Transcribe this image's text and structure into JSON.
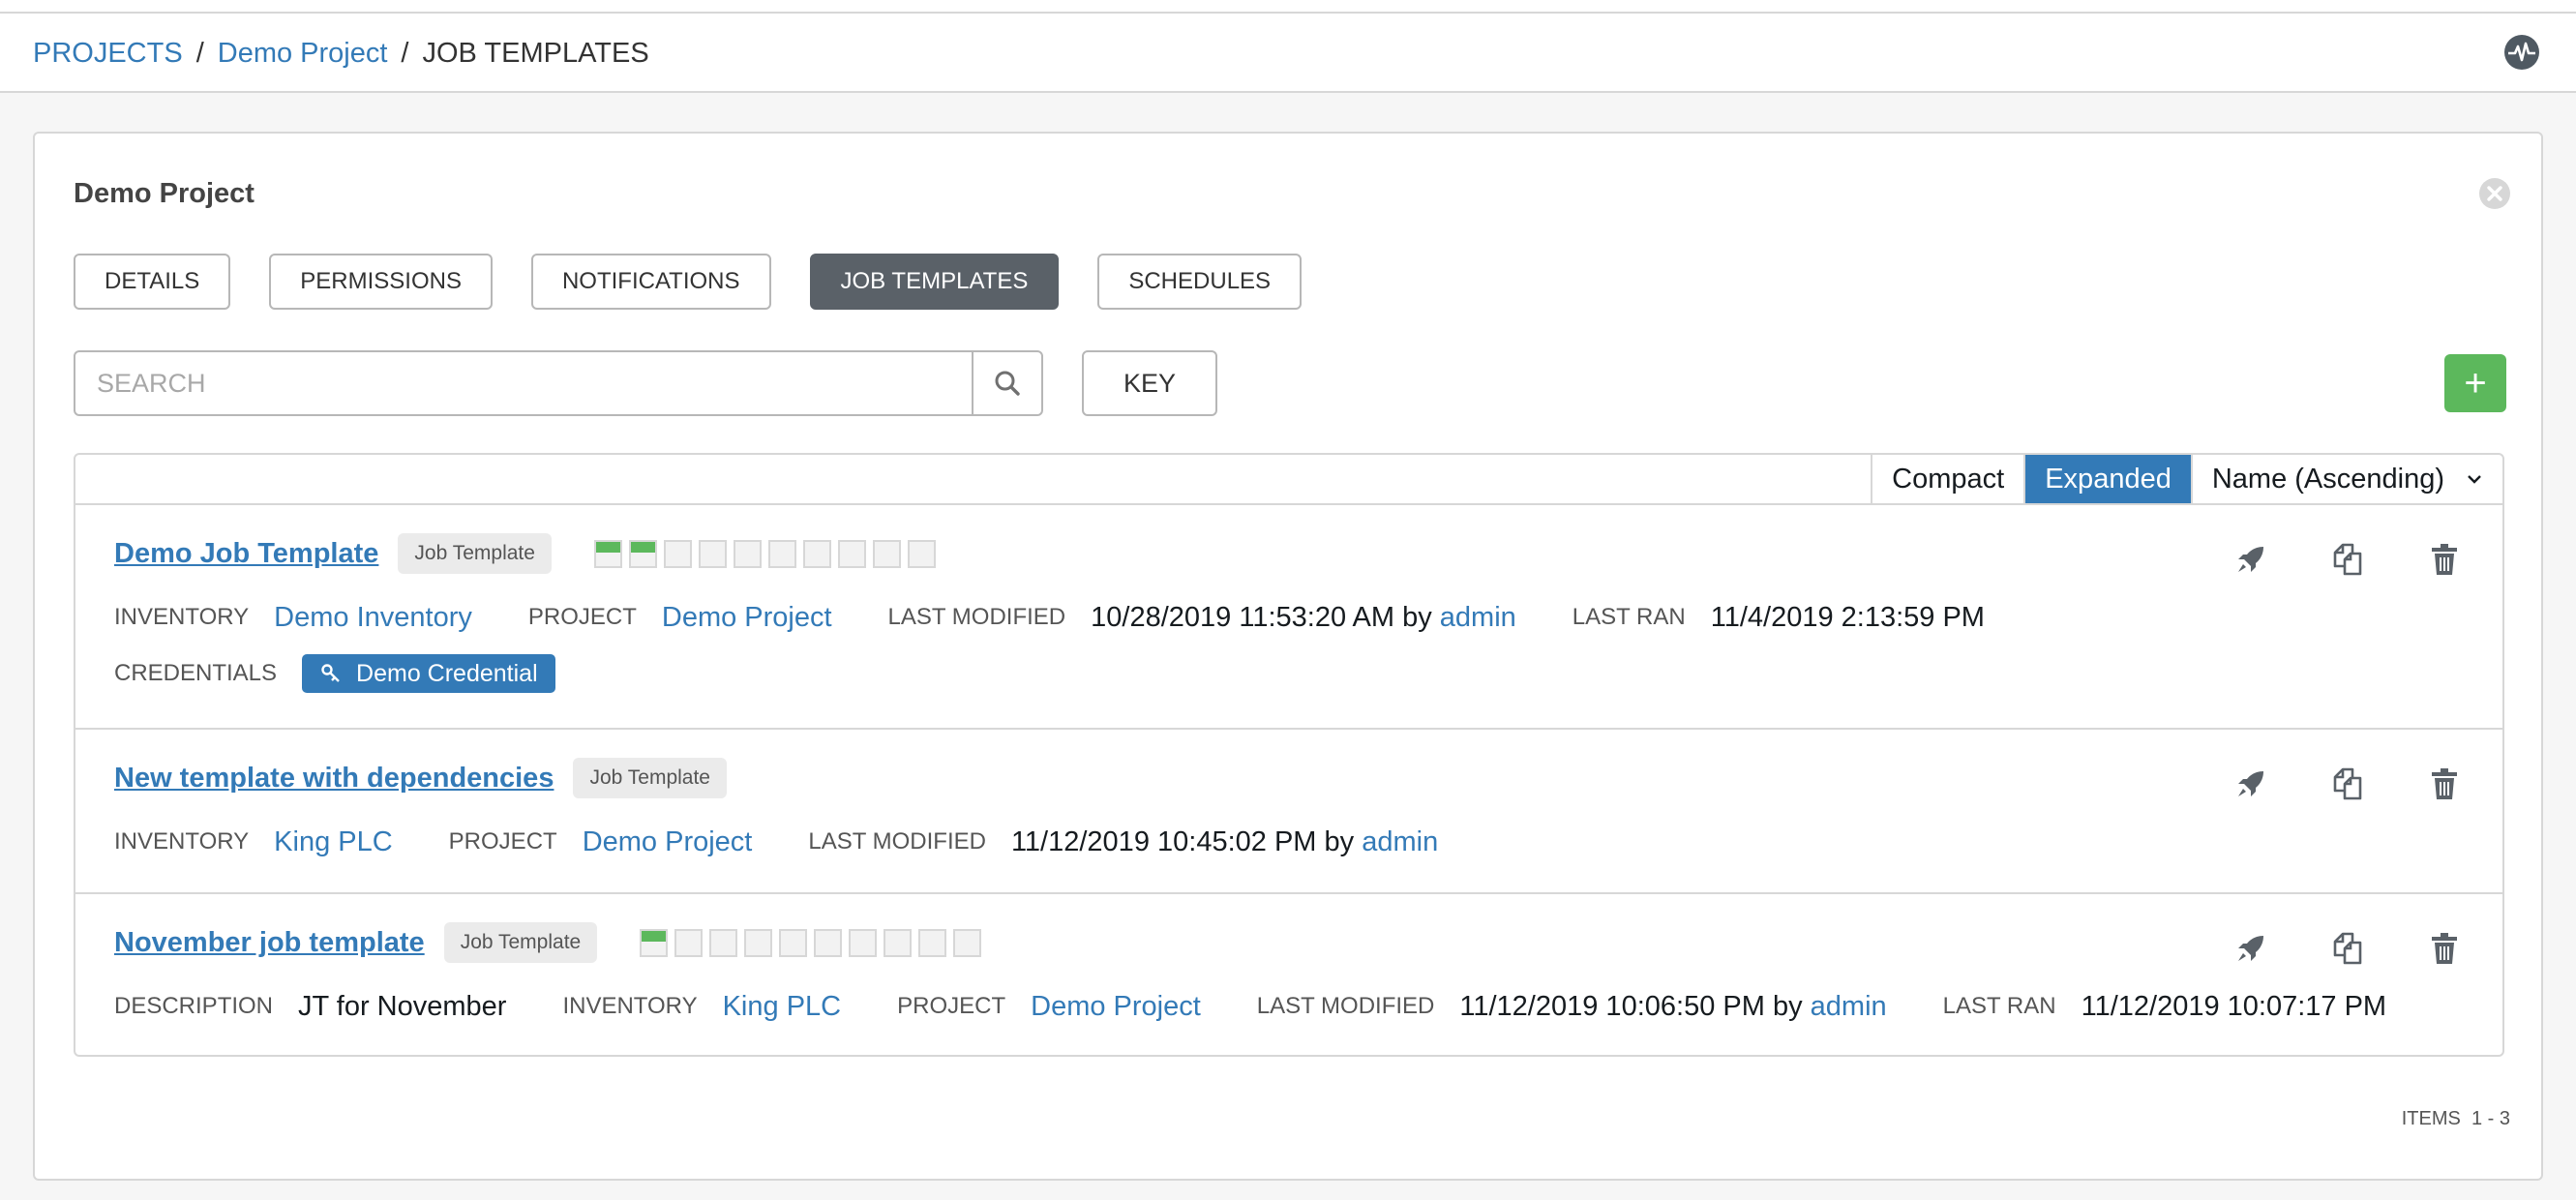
{
  "breadcrumb": {
    "items": [
      "PROJECTS",
      "Demo Project"
    ],
    "current": "JOB TEMPLATES"
  },
  "panel": {
    "title": "Demo Project",
    "tabs": [
      {
        "label": "DETAILS",
        "active": false
      },
      {
        "label": "PERMISSIONS",
        "active": false
      },
      {
        "label": "NOTIFICATIONS",
        "active": false
      },
      {
        "label": "JOB TEMPLATES",
        "active": true
      },
      {
        "label": "SCHEDULES",
        "active": false
      }
    ],
    "search": {
      "placeholder": "SEARCH",
      "value": ""
    },
    "key_label": "KEY",
    "add_label": "+"
  },
  "list_header": {
    "compact_label": "Compact",
    "expanded_label": "Expanded",
    "sort_value": "Name (Ascending)"
  },
  "templates": [
    {
      "name": "Demo Job Template",
      "badge": "Job Template",
      "recent_jobs": [
        "successful",
        "successful",
        "none",
        "none",
        "none",
        "none",
        "none",
        "none",
        "none",
        "none"
      ],
      "inventory_label": "INVENTORY",
      "inventory": "Demo Inventory",
      "project_label": "PROJECT",
      "project": "Demo Project",
      "last_modified_label": "LAST MODIFIED",
      "last_modified": "10/28/2019 11:53:20 AM",
      "by_text": "by",
      "modified_by": "admin",
      "last_ran_label": "LAST RAN",
      "last_ran": "11/4/2019 2:13:59 PM",
      "credentials_label": "CREDENTIALS",
      "credential": "Demo Credential"
    },
    {
      "name": "New template with dependencies",
      "badge": "Job Template",
      "inventory_label": "INVENTORY",
      "inventory": "King PLC",
      "project_label": "PROJECT",
      "project": "Demo Project",
      "last_modified_label": "LAST MODIFIED",
      "last_modified": "11/12/2019 10:45:02 PM",
      "by_text": "by",
      "modified_by": "admin"
    },
    {
      "name": "November job template",
      "badge": "Job Template",
      "recent_jobs": [
        "successful",
        "none",
        "none",
        "none",
        "none",
        "none",
        "none",
        "none",
        "none",
        "none"
      ],
      "description_label": "DESCRIPTION",
      "description": "JT for November",
      "inventory_label": "INVENTORY",
      "inventory": "King PLC",
      "project_label": "PROJECT",
      "project": "Demo Project",
      "last_modified_label": "LAST MODIFIED",
      "last_modified": "11/12/2019 10:06:50 PM",
      "by_text": "by",
      "modified_by": "admin",
      "last_ran_label": "LAST RAN",
      "last_ran": "11/12/2019 10:07:17 PM"
    }
  ],
  "footer": {
    "items_label": "ITEMS",
    "items_range": "1 - 3"
  },
  "colors": {
    "link": "#337ab7",
    "active_tab": "#5a6168",
    "add_button": "#5cb85c",
    "success": "#5cb85c"
  },
  "icons": [
    "activity-stream-icon",
    "close-icon",
    "search-icon",
    "chevron-down-icon",
    "key-icon",
    "launch-rocket-icon",
    "copy-icon",
    "delete-icon"
  ]
}
